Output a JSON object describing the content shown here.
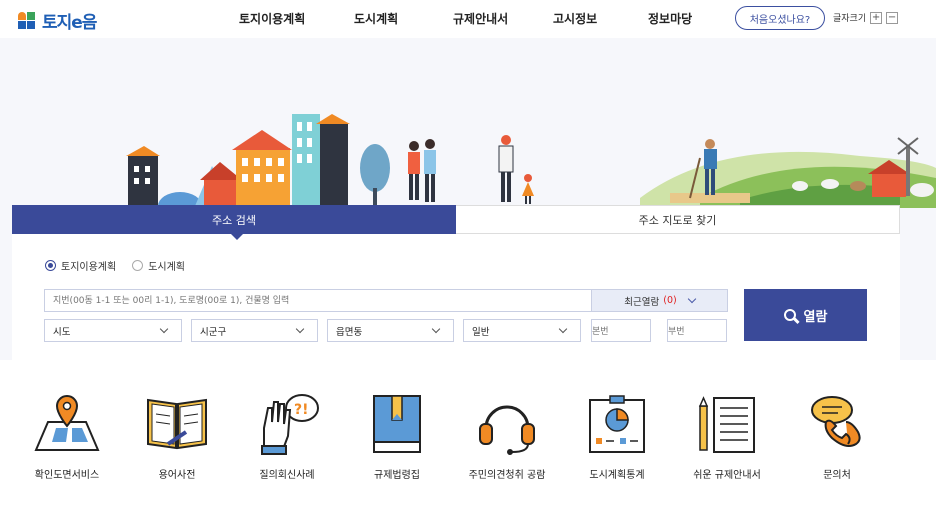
{
  "header": {
    "logo_text": "토지e음",
    "nav": [
      "토지이용계획",
      "도시계획",
      "규제안내서",
      "고시정보",
      "정보마당"
    ],
    "first_visit": "처음오셨나요?",
    "font_size_label": "글자크기",
    "font_plus": "+",
    "font_minus": "−"
  },
  "search": {
    "tabs": [
      "주소 검색",
      "주소 지도로 찾기"
    ],
    "radios": [
      "토지이용계획",
      "도시계획"
    ],
    "selected_radio": "토지이용계획",
    "address_placeholder": "지번(00동 1-1 또는 00리 1-1), 도로명(00로 1), 건물명 입력",
    "recent_label": "최근열람",
    "recent_count": "(0)",
    "selects": [
      "시도",
      "시군구",
      "읍면동",
      "일반"
    ],
    "main_no_placeholder": "본번",
    "sub_no_placeholder": "부번",
    "dash": "-",
    "open_button": "열람"
  },
  "services": [
    {
      "label": "확인도면서비스",
      "icon": "map-pin-icon"
    },
    {
      "label": "용어사전",
      "icon": "dictionary-book-icon"
    },
    {
      "label": "질의회신사례",
      "icon": "question-hand-icon"
    },
    {
      "label": "규제법령집",
      "icon": "law-book-icon"
    },
    {
      "label": "주민의견청취 공람",
      "icon": "headset-icon"
    },
    {
      "label": "도시계획통계",
      "icon": "statistics-board-icon"
    },
    {
      "label": "쉬운 규제안내서",
      "icon": "document-pencil-icon"
    },
    {
      "label": "문의처",
      "icon": "phone-chat-icon"
    }
  ],
  "colors": {
    "primary": "#3a4a99",
    "logo_blue": "#1f5fb5",
    "accent_orange": "#f08a24",
    "recent_count": "#e02020"
  }
}
